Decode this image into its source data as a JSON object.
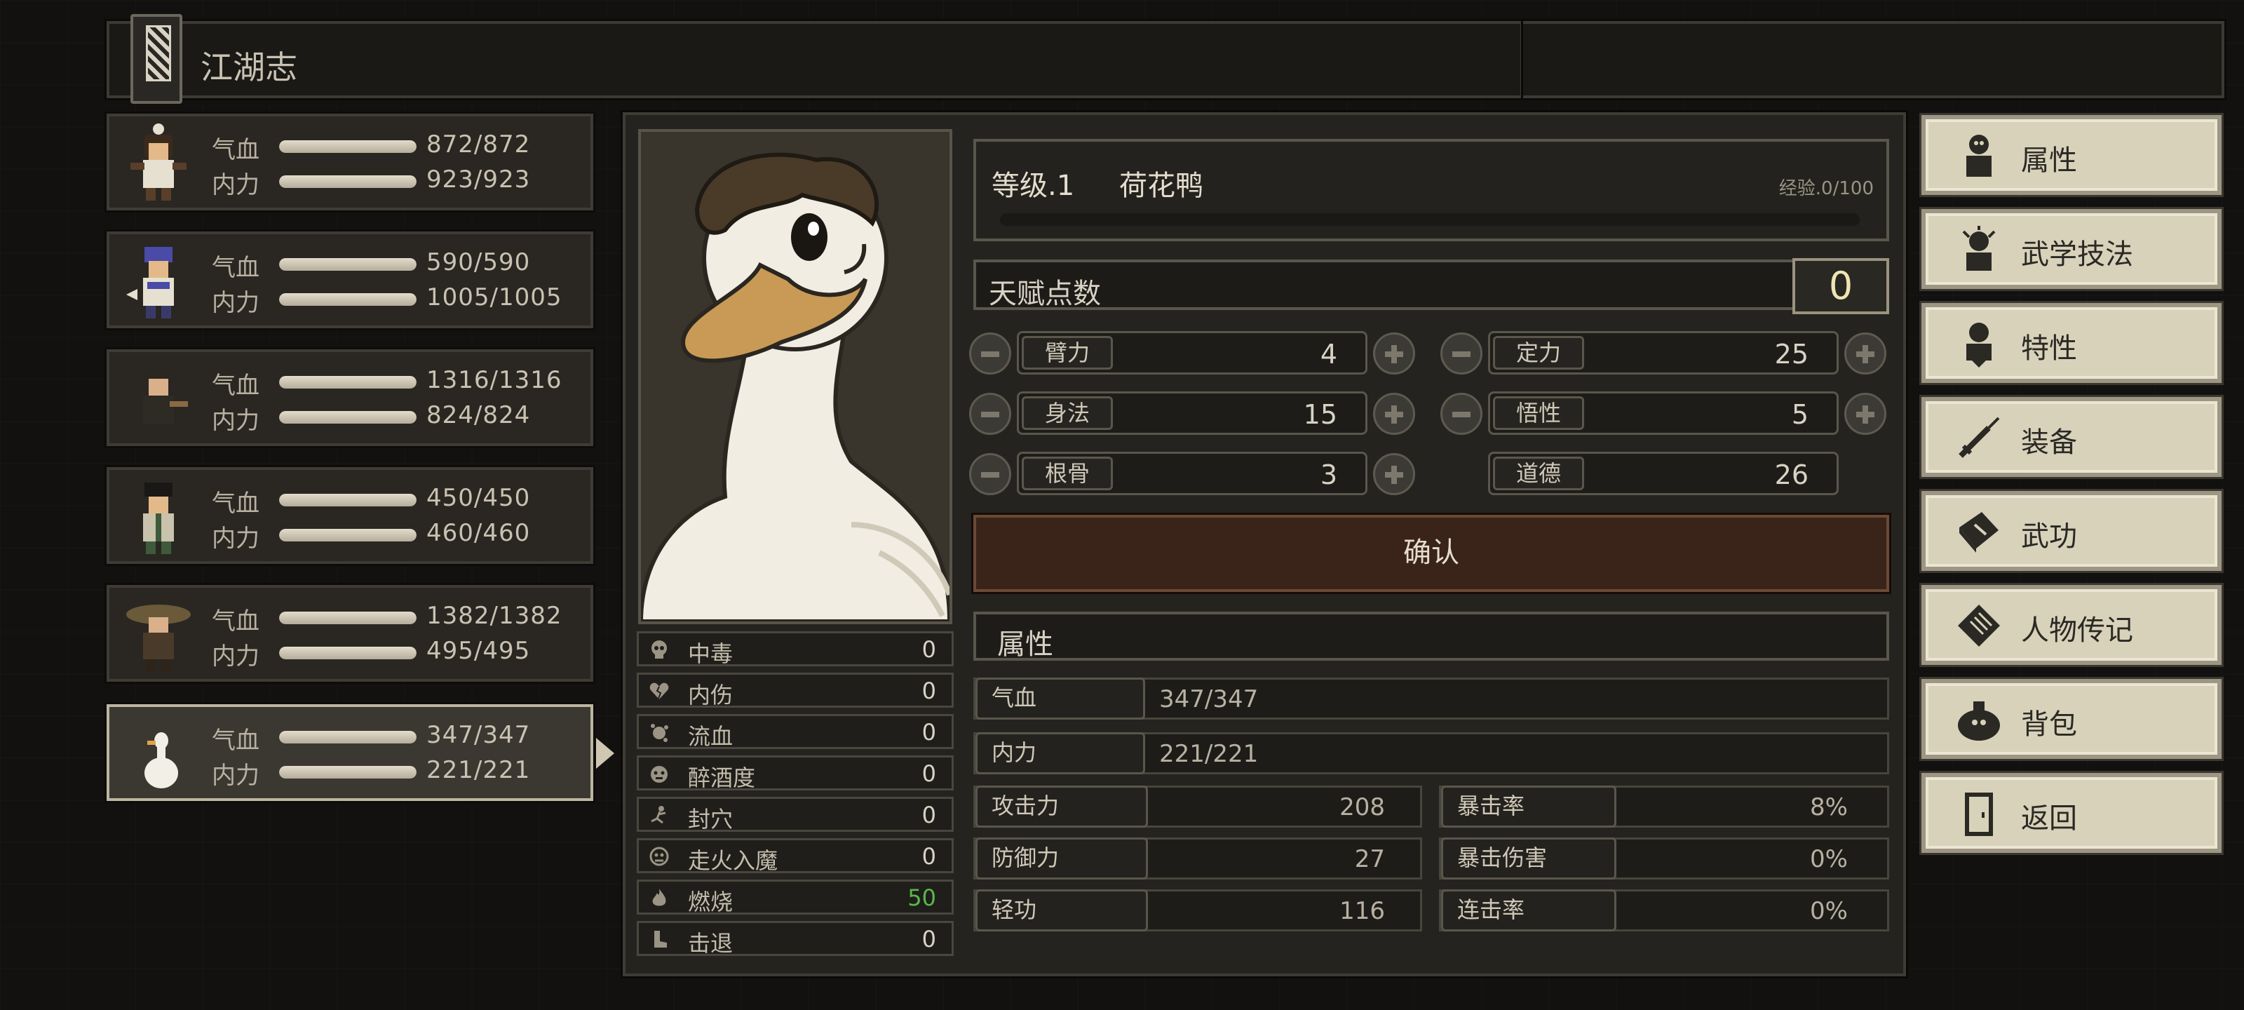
{
  "header": {
    "title": "江湖志"
  },
  "party": [
    {
      "hp_label": "气血",
      "hp": "872/872",
      "hp_frac": 1.0,
      "mp_label": "内力",
      "mp": "923/923",
      "mp_frac": 1.0
    },
    {
      "hp_label": "气血",
      "hp": "590/590",
      "hp_frac": 1.0,
      "mp_label": "内力",
      "mp": "1005/1005",
      "mp_frac": 1.0
    },
    {
      "hp_label": "气血",
      "hp": "1316/1316",
      "hp_frac": 1.0,
      "mp_label": "内力",
      "mp": "824/824",
      "mp_frac": 1.0
    },
    {
      "hp_label": "气血",
      "hp": "450/450",
      "hp_frac": 1.0,
      "mp_label": "内力",
      "mp": "460/460",
      "mp_frac": 1.0
    },
    {
      "hp_label": "气血",
      "hp": "1382/1382",
      "hp_frac": 1.0,
      "mp_label": "内力",
      "mp": "495/495",
      "mp_frac": 1.0
    },
    {
      "hp_label": "气血",
      "hp": "347/347",
      "hp_frac": 1.0,
      "mp_label": "内力",
      "mp": "221/221",
      "mp_frac": 1.0,
      "selected": true
    }
  ],
  "character": {
    "level": "等级.1",
    "name": "荷花鸭",
    "exp": "经验.0/100",
    "exp_frac": 0.0
  },
  "talent": {
    "label": "天赋点数",
    "value": "0"
  },
  "attributes": {
    "arm": {
      "label": "臂力",
      "value": "4"
    },
    "calm": {
      "label": "定力",
      "value": "25"
    },
    "agility": {
      "label": "身法",
      "value": "15"
    },
    "insight": {
      "label": "悟性",
      "value": "5"
    },
    "bone": {
      "label": "根骨",
      "value": "3"
    },
    "morality": {
      "label": "道德",
      "value": "26"
    }
  },
  "confirm_label": "确认",
  "properties": {
    "header": "属性",
    "hp": {
      "label": "气血",
      "value": "347/347"
    },
    "mp": {
      "label": "内力",
      "value": "221/221"
    },
    "attack": {
      "label": "攻击力",
      "value": "208"
    },
    "defense": {
      "label": "防御力",
      "value": "27"
    },
    "qinggong": {
      "label": "轻功",
      "value": "116"
    },
    "crit_rate": {
      "label": "暴击率",
      "value": "8%"
    },
    "crit_dmg": {
      "label": "暴击伤害",
      "value": "0%"
    },
    "combo_rate": {
      "label": "连击率",
      "value": "0%"
    }
  },
  "status_effects": [
    {
      "name": "中毒",
      "value": "0",
      "icon": "skull-icon"
    },
    {
      "name": "内伤",
      "value": "0",
      "icon": "broken-heart-icon"
    },
    {
      "name": "流血",
      "value": "0",
      "icon": "blood-icon"
    },
    {
      "name": "醉酒度",
      "value": "0",
      "icon": "drunk-face-icon"
    },
    {
      "name": "封穴",
      "value": "0",
      "icon": "acupoint-icon"
    },
    {
      "name": "走火入魔",
      "value": "0",
      "icon": "demon-icon"
    },
    {
      "name": "燃烧",
      "value": "50",
      "icon": "flame-icon",
      "highlight": "#59b84a"
    },
    {
      "name": "击退",
      "value": "0",
      "icon": "boot-icon"
    }
  ],
  "menu": [
    {
      "label": "属性",
      "icon": "character-icon"
    },
    {
      "label": "武学技法",
      "icon": "skill-figure-icon"
    },
    {
      "label": "特性",
      "icon": "trait-figure-icon"
    },
    {
      "label": "装备",
      "icon": "sword-icon"
    },
    {
      "label": "武功",
      "icon": "manual-book-icon"
    },
    {
      "label": "人物传记",
      "icon": "scroll-icon"
    },
    {
      "label": "背包",
      "icon": "bag-icon"
    },
    {
      "label": "返回",
      "icon": "door-icon"
    }
  ]
}
